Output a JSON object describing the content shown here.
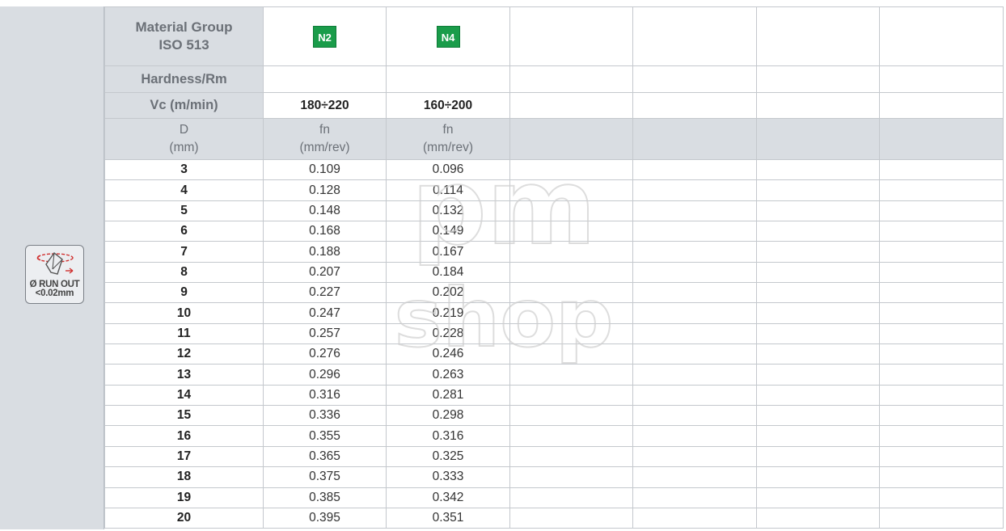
{
  "sidebar": {
    "runout_line1": "Ø RUN OUT",
    "runout_line2": "<0.02mm",
    "runout_icon": "drill-runout-icon"
  },
  "header": {
    "material_group": "Material Group",
    "iso": "ISO 513",
    "hardness": "Hardness/Rm",
    "vc": "Vc (m/min)",
    "d_label": "D",
    "d_unit": "(mm)",
    "fn_label": "fn",
    "fn_unit": "(mm/rev)"
  },
  "materials": [
    {
      "code": "N2",
      "color": "#1a9c4a",
      "hardness": "",
      "vc": "180÷220"
    },
    {
      "code": "N4",
      "color": "#1a9c4a",
      "hardness": "",
      "vc": "160÷200"
    }
  ],
  "rows": [
    {
      "d": "3",
      "fn": [
        "0.109",
        "0.096"
      ]
    },
    {
      "d": "4",
      "fn": [
        "0.128",
        "0.114"
      ]
    },
    {
      "d": "5",
      "fn": [
        "0.148",
        "0.132"
      ]
    },
    {
      "d": "6",
      "fn": [
        "0.168",
        "0.149"
      ]
    },
    {
      "d": "7",
      "fn": [
        "0.188",
        "0.167"
      ]
    },
    {
      "d": "8",
      "fn": [
        "0.207",
        "0.184"
      ]
    },
    {
      "d": "9",
      "fn": [
        "0.227",
        "0.202"
      ]
    },
    {
      "d": "10",
      "fn": [
        "0.247",
        "0.219"
      ]
    },
    {
      "d": "11",
      "fn": [
        "0.257",
        "0.228"
      ]
    },
    {
      "d": "12",
      "fn": [
        "0.276",
        "0.246"
      ]
    },
    {
      "d": "13",
      "fn": [
        "0.296",
        "0.263"
      ]
    },
    {
      "d": "14",
      "fn": [
        "0.316",
        "0.281"
      ]
    },
    {
      "d": "15",
      "fn": [
        "0.336",
        "0.298"
      ]
    },
    {
      "d": "16",
      "fn": [
        "0.355",
        "0.316"
      ]
    },
    {
      "d": "17",
      "fn": [
        "0.365",
        "0.325"
      ]
    },
    {
      "d": "18",
      "fn": [
        "0.375",
        "0.333"
      ]
    },
    {
      "d": "19",
      "fn": [
        "0.385",
        "0.342"
      ]
    },
    {
      "d": "20",
      "fn": [
        "0.395",
        "0.351"
      ]
    }
  ],
  "watermark": {
    "line1": "pm",
    "line2": "shop"
  }
}
